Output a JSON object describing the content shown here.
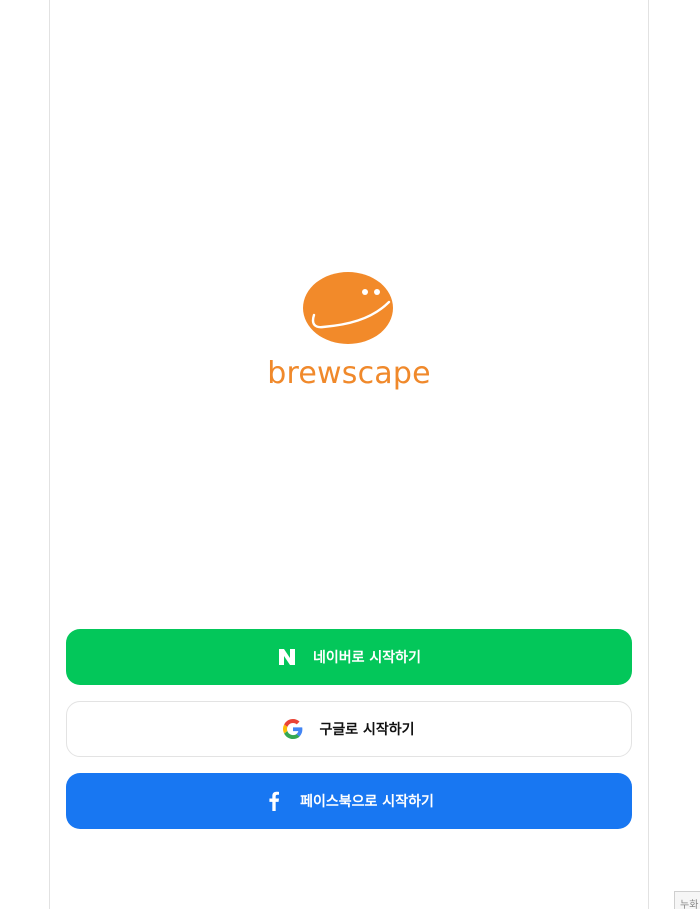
{
  "brand": {
    "name": "brewscape",
    "color": "#f0892b"
  },
  "login_buttons": {
    "naver": {
      "label": "네이버로 시작하기",
      "icon": "naver-n-icon",
      "color": "#03c75a"
    },
    "google": {
      "label": "구글로 시작하기",
      "icon": "google-g-icon",
      "color": "#ffffff"
    },
    "facebook": {
      "label": "페이스북으로 시작하기",
      "icon": "facebook-f-icon",
      "color": "#1877f2"
    }
  },
  "corner_widget": {
    "text": "누화"
  }
}
